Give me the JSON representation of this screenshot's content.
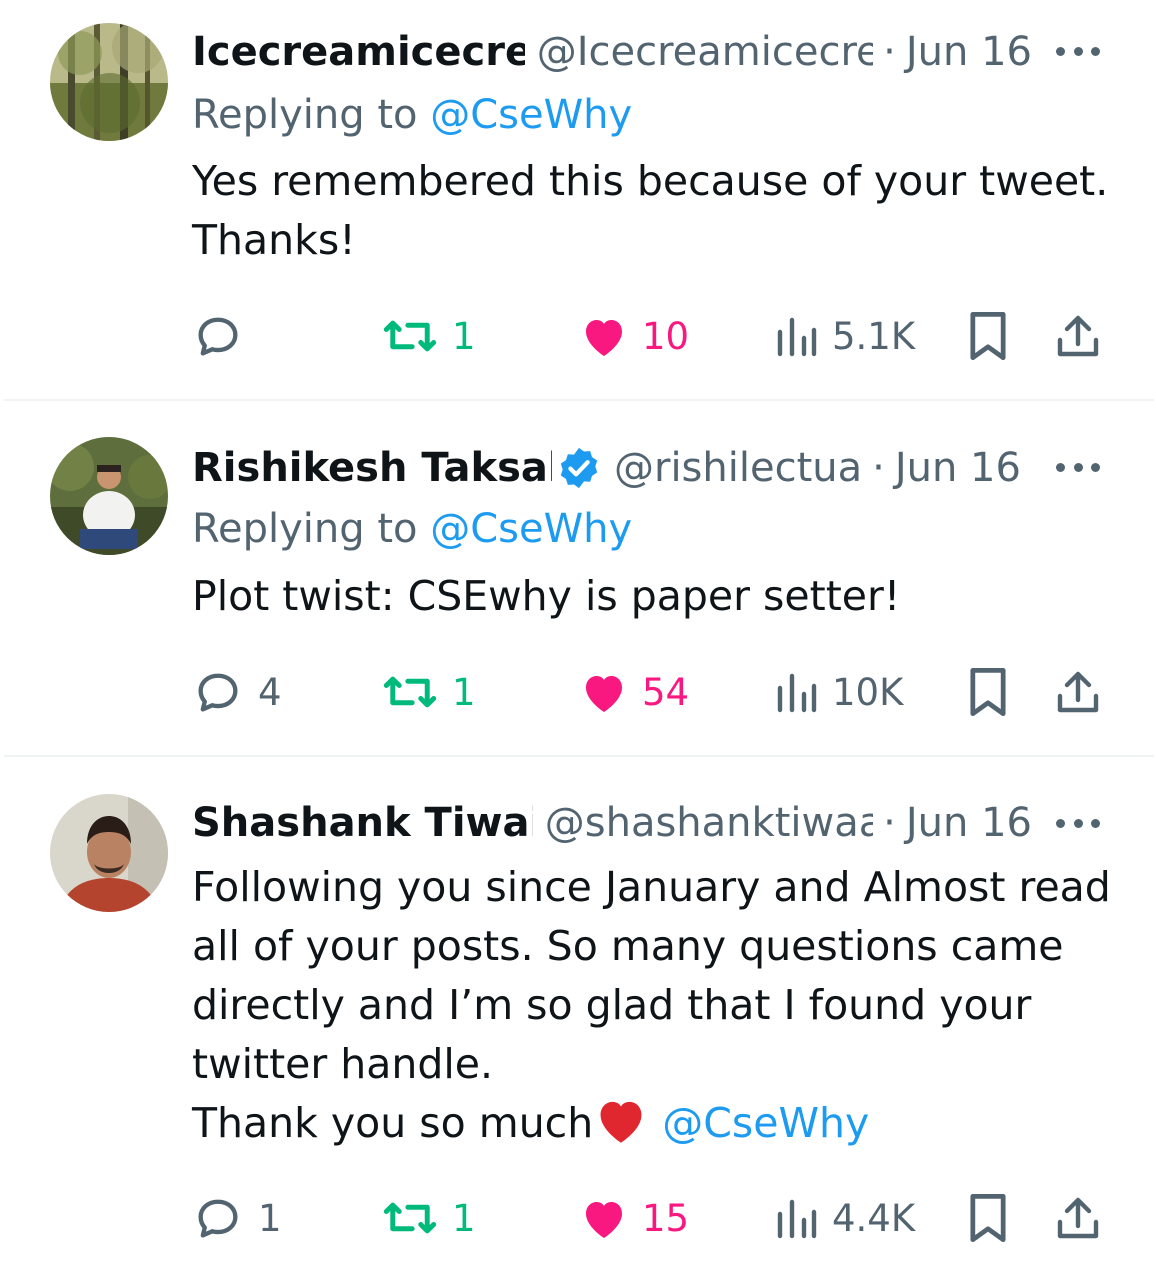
{
  "colors": {
    "text": "#0f1419",
    "secondary": "#536471",
    "link": "#1d9bf0",
    "retweet": "#00ba7c",
    "like": "#f91880",
    "divider": "#eff3f4"
  },
  "tweets": [
    {
      "name": "Icecreamicecre",
      "handle": "@Icecreamicecre",
      "sep": "·",
      "date": "Jun 16",
      "verified": false,
      "replying_prefix": "Replying to ",
      "replying_to": "@CseWhy",
      "body_lines": [
        "Yes remembered this because of your tweet.",
        "Thanks!"
      ],
      "replies": "",
      "retweets": "1",
      "likes": "10",
      "views": "5.1K",
      "icons": {
        "reply": "reply-icon",
        "retweet": "retweet-icon",
        "like": "heart-icon",
        "views": "views-icon",
        "bookmark": "bookmark-icon",
        "share": "share-icon",
        "more": "more-icon"
      }
    },
    {
      "name": "Rishikesh Taksal",
      "handle": "@rishilectua",
      "sep": "·",
      "date": "Jun 16",
      "verified": true,
      "replying_prefix": "Replying to ",
      "replying_to": "@CseWhy",
      "body_lines": [
        "Plot twist: CSEwhy is paper setter!"
      ],
      "replies": "4",
      "retweets": "1",
      "likes": "54",
      "views": "10K"
    },
    {
      "name": "Shashank Tiwai",
      "handle": "@shashanktiwaa",
      "sep": "·",
      "date": "Jun 16",
      "verified": false,
      "body_lines": [
        "Following you since January and Almost read",
        "all of your posts. So many questions came",
        "directly and I’m so glad that I found your",
        "twitter handle."
      ],
      "last_line_text": "Thank you so much",
      "last_line_emoji": "red-heart-emoji",
      "last_line_mention": "@CseWhy",
      "replies": "1",
      "retweets": "1",
      "likes": "15",
      "views": "4.4K"
    }
  ]
}
